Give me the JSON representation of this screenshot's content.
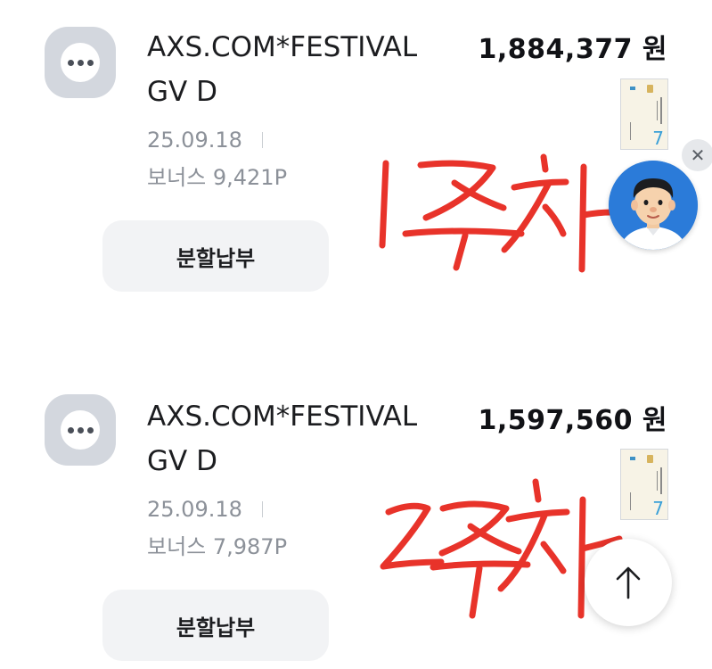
{
  "transactions": [
    {
      "merchant": "AXS.COM*FESTIVAL GV D",
      "amount": "1,884,377 원",
      "date": "25.09.18",
      "bonus": "보너스 9,421P",
      "action_label": "분할납부",
      "icon": "more-dots-icon"
    },
    {
      "merchant": "AXS.COM*FESTIVAL GV D",
      "amount": "1,597,560 원",
      "date": "25.09.18",
      "bonus": "보너스 7,987P",
      "action_label": "분할납부",
      "icon": "more-dots-icon"
    }
  ],
  "annotations": {
    "first": "1주차",
    "second": "2주차",
    "color": "#e8332a"
  },
  "floating": {
    "chatbot_icon": "assistant-avatar-icon",
    "close_icon": "close-icon",
    "scroll_top_icon": "arrow-up-icon"
  },
  "colors": {
    "icon_box": "#d3d7de",
    "button_bg": "#f2f3f5",
    "secondary_text": "#8c9199",
    "avatar_bg": "#2b7bd9"
  }
}
